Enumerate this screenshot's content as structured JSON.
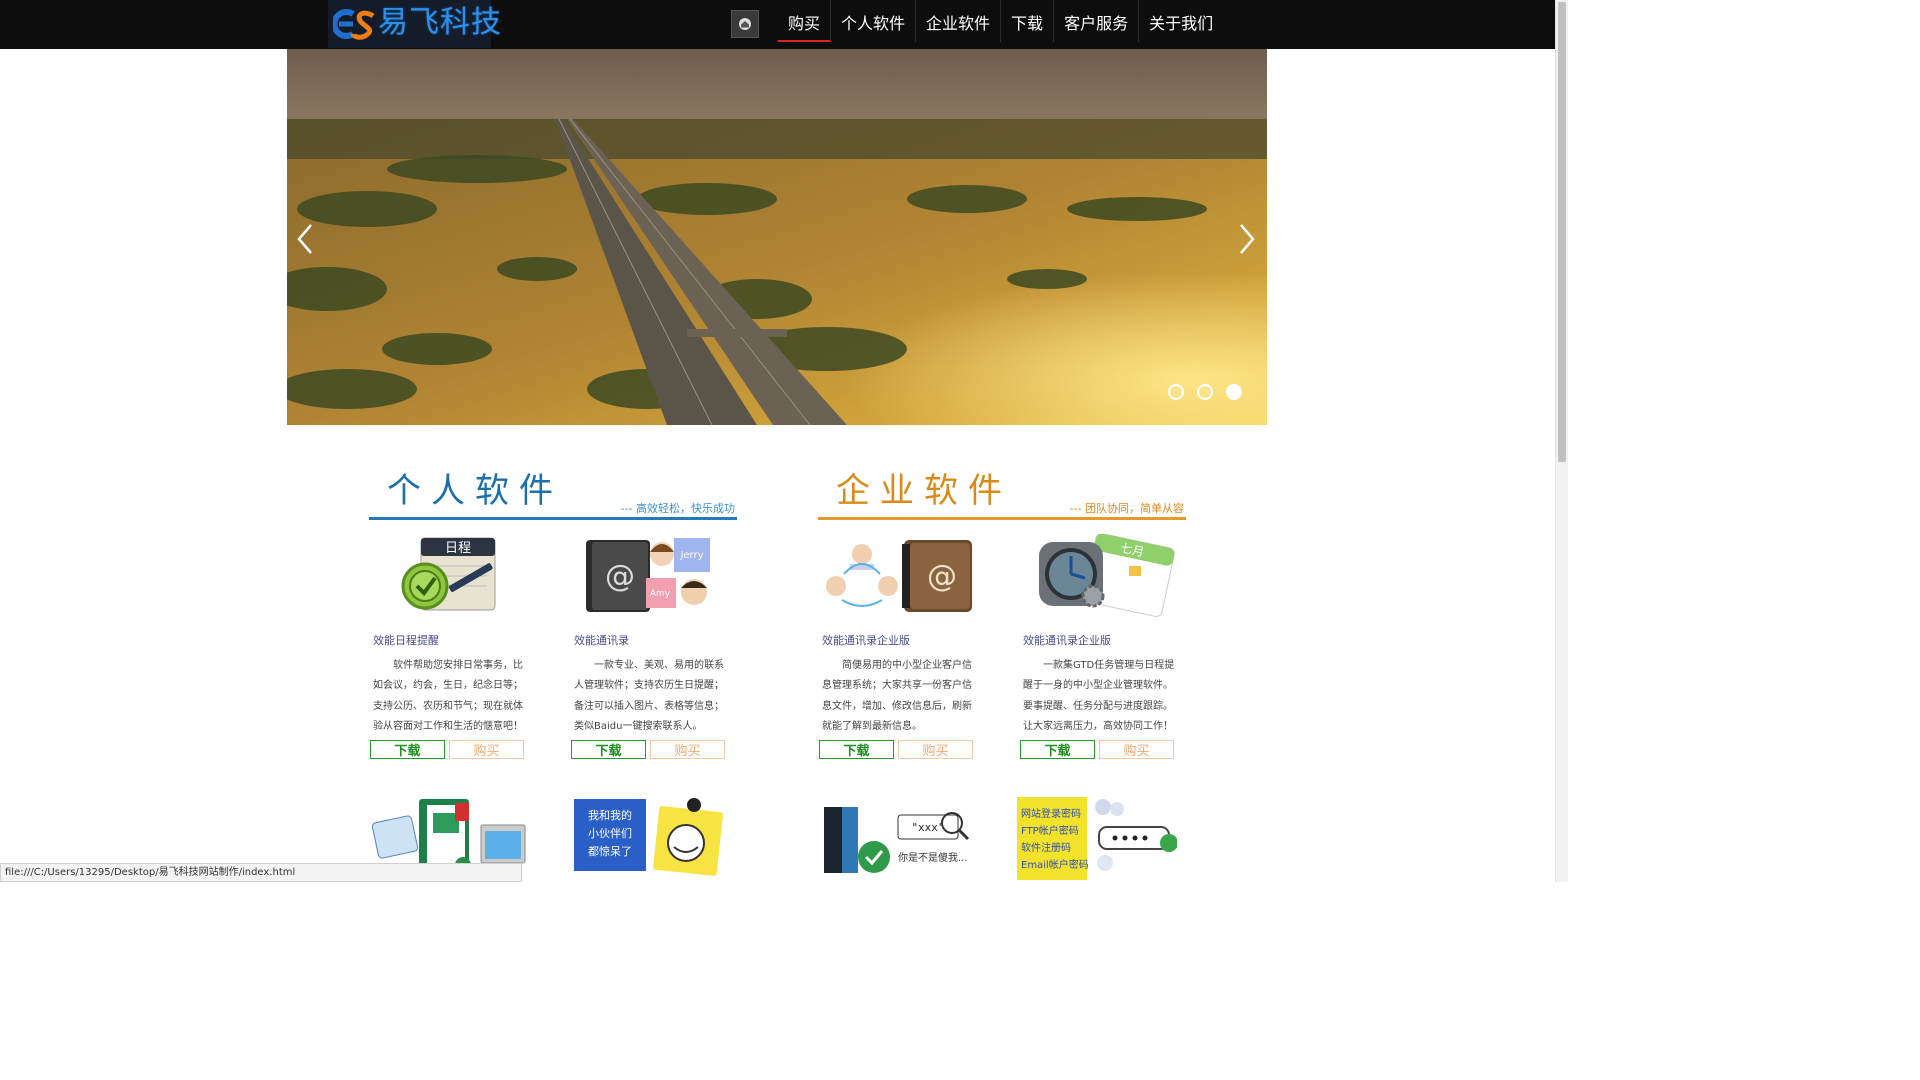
{
  "header": {
    "brand": "易飞科技",
    "nav": [
      "购买",
      "个人软件",
      "企业软件",
      "下载",
      "客户服务",
      "关于我们"
    ],
    "active_nav": "购买",
    "accent_color": "#d8261e"
  },
  "banner": {
    "slide_count": 3,
    "active_slide": 3
  },
  "personal": {
    "title": "个人软件",
    "slogan": "--- 高效轻松，快乐成功",
    "color": "#2479b6",
    "products": [
      {
        "name": "效能日程提醒",
        "desc": "软件帮助您安排日常事务，比如会议，约会，生日，纪念日等；支持公历、农历和节气；现在就体验从容面对工作和生活的惬意吧！",
        "download": "下载",
        "buy": "购买",
        "thumb_text": "日程"
      },
      {
        "name": "效能通讯录",
        "desc": "一款专业、美观、易用的联系人管理软件；支持农历生日提醒；备注可以插入图片、表格等信息；类似Baidu一键搜索联系人。",
        "download": "下载",
        "buy": "购买",
        "thumb_names": [
          "Jerry",
          "Amy"
        ]
      }
    ]
  },
  "enterprise": {
    "title": "企业软件",
    "slogan": "--- 团队协同，简单从容",
    "color": "#e49a2c",
    "products": [
      {
        "name": "效能通讯录企业版",
        "desc": "简便易用的中小型企业客户信息管理系统；大家共享一份客户信息文件，增加、修改信息后，刷新就能了解到最新信息。",
        "download": "下载",
        "buy": "购买"
      },
      {
        "name": "效能通讯录企业版",
        "desc": "一款集GTD任务管理与日程提醒于一身的中小型企业管理软件。要事提醒、任务分配与进度跟踪。让大家远离压力，高效协同工作！",
        "download": "下载",
        "buy": "购买",
        "thumb_text": "七月"
      }
    ]
  },
  "second_row": {
    "note_text": [
      "我和我的",
      "小伙伴们",
      "都惊呆了"
    ],
    "quote_text": "\"xxx\"",
    "handwriting": "你是不是傻我...",
    "password_card": [
      "网站登录密码",
      "FTP帐户密码",
      "软件注册码",
      "Email帐户密码"
    ]
  },
  "statusbar": {
    "url": "file:///C:/Users/13295/Desktop/易飞科技网站制作/index.html"
  }
}
